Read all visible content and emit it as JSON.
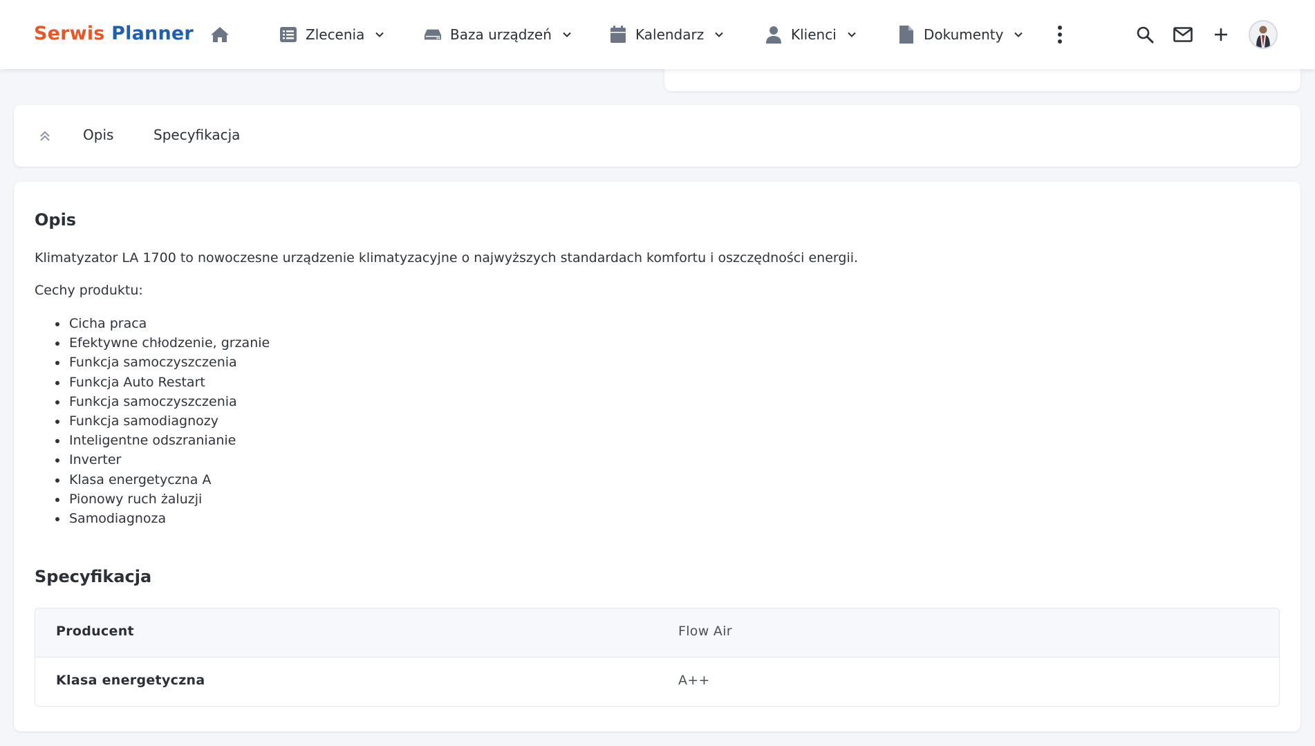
{
  "app": {
    "logo_part1": "Serwis",
    "logo_part2": "Planner",
    "logo_color1": "#e8572a",
    "logo_color2": "#1f5fb0"
  },
  "nav": {
    "home_icon": "home-icon",
    "items": [
      {
        "label": "Zlecenia",
        "icon": "list-icon"
      },
      {
        "label": "Baza urządzeń",
        "icon": "device-icon"
      },
      {
        "label": "Kalendarz",
        "icon": "calendar-icon"
      },
      {
        "label": "Klienci",
        "icon": "user-icon"
      },
      {
        "label": "Dokumenty",
        "icon": "document-icon"
      }
    ],
    "more_icon": "more-vertical-icon",
    "right_icons": [
      "search-icon",
      "mail-icon",
      "plus-icon",
      "avatar"
    ]
  },
  "tabs": {
    "collapse_icon": "chevron-double-up-icon",
    "items": [
      {
        "label": "Opis"
      },
      {
        "label": "Specyfikacja"
      }
    ]
  },
  "description": {
    "title": "Opis",
    "intro": "Klimatyzator LA 1700 to nowoczesne urządzenie klimatyzacyjne o najwyższych standardach komfortu i oszczędności energii.",
    "features_heading": "Cechy produktu:",
    "features": [
      "Cicha praca",
      "Efektywne chłodzenie, grzanie",
      "Funkcja samoczyszczenia",
      "Funkcja Auto Restart",
      "Funkcja samoczyszczenia",
      "Funkcja samodiagnozy",
      "Inteligentne odszranianie",
      "Inverter",
      "Klasa energetyczna A",
      "Pionowy ruch żaluzji",
      "Samodiagnoza"
    ]
  },
  "specification": {
    "title": "Specyfikacja",
    "rows": [
      {
        "key": "Producent",
        "value": "Flow Air"
      },
      {
        "key": "Klasa energetyczna",
        "value": "A++"
      }
    ]
  }
}
